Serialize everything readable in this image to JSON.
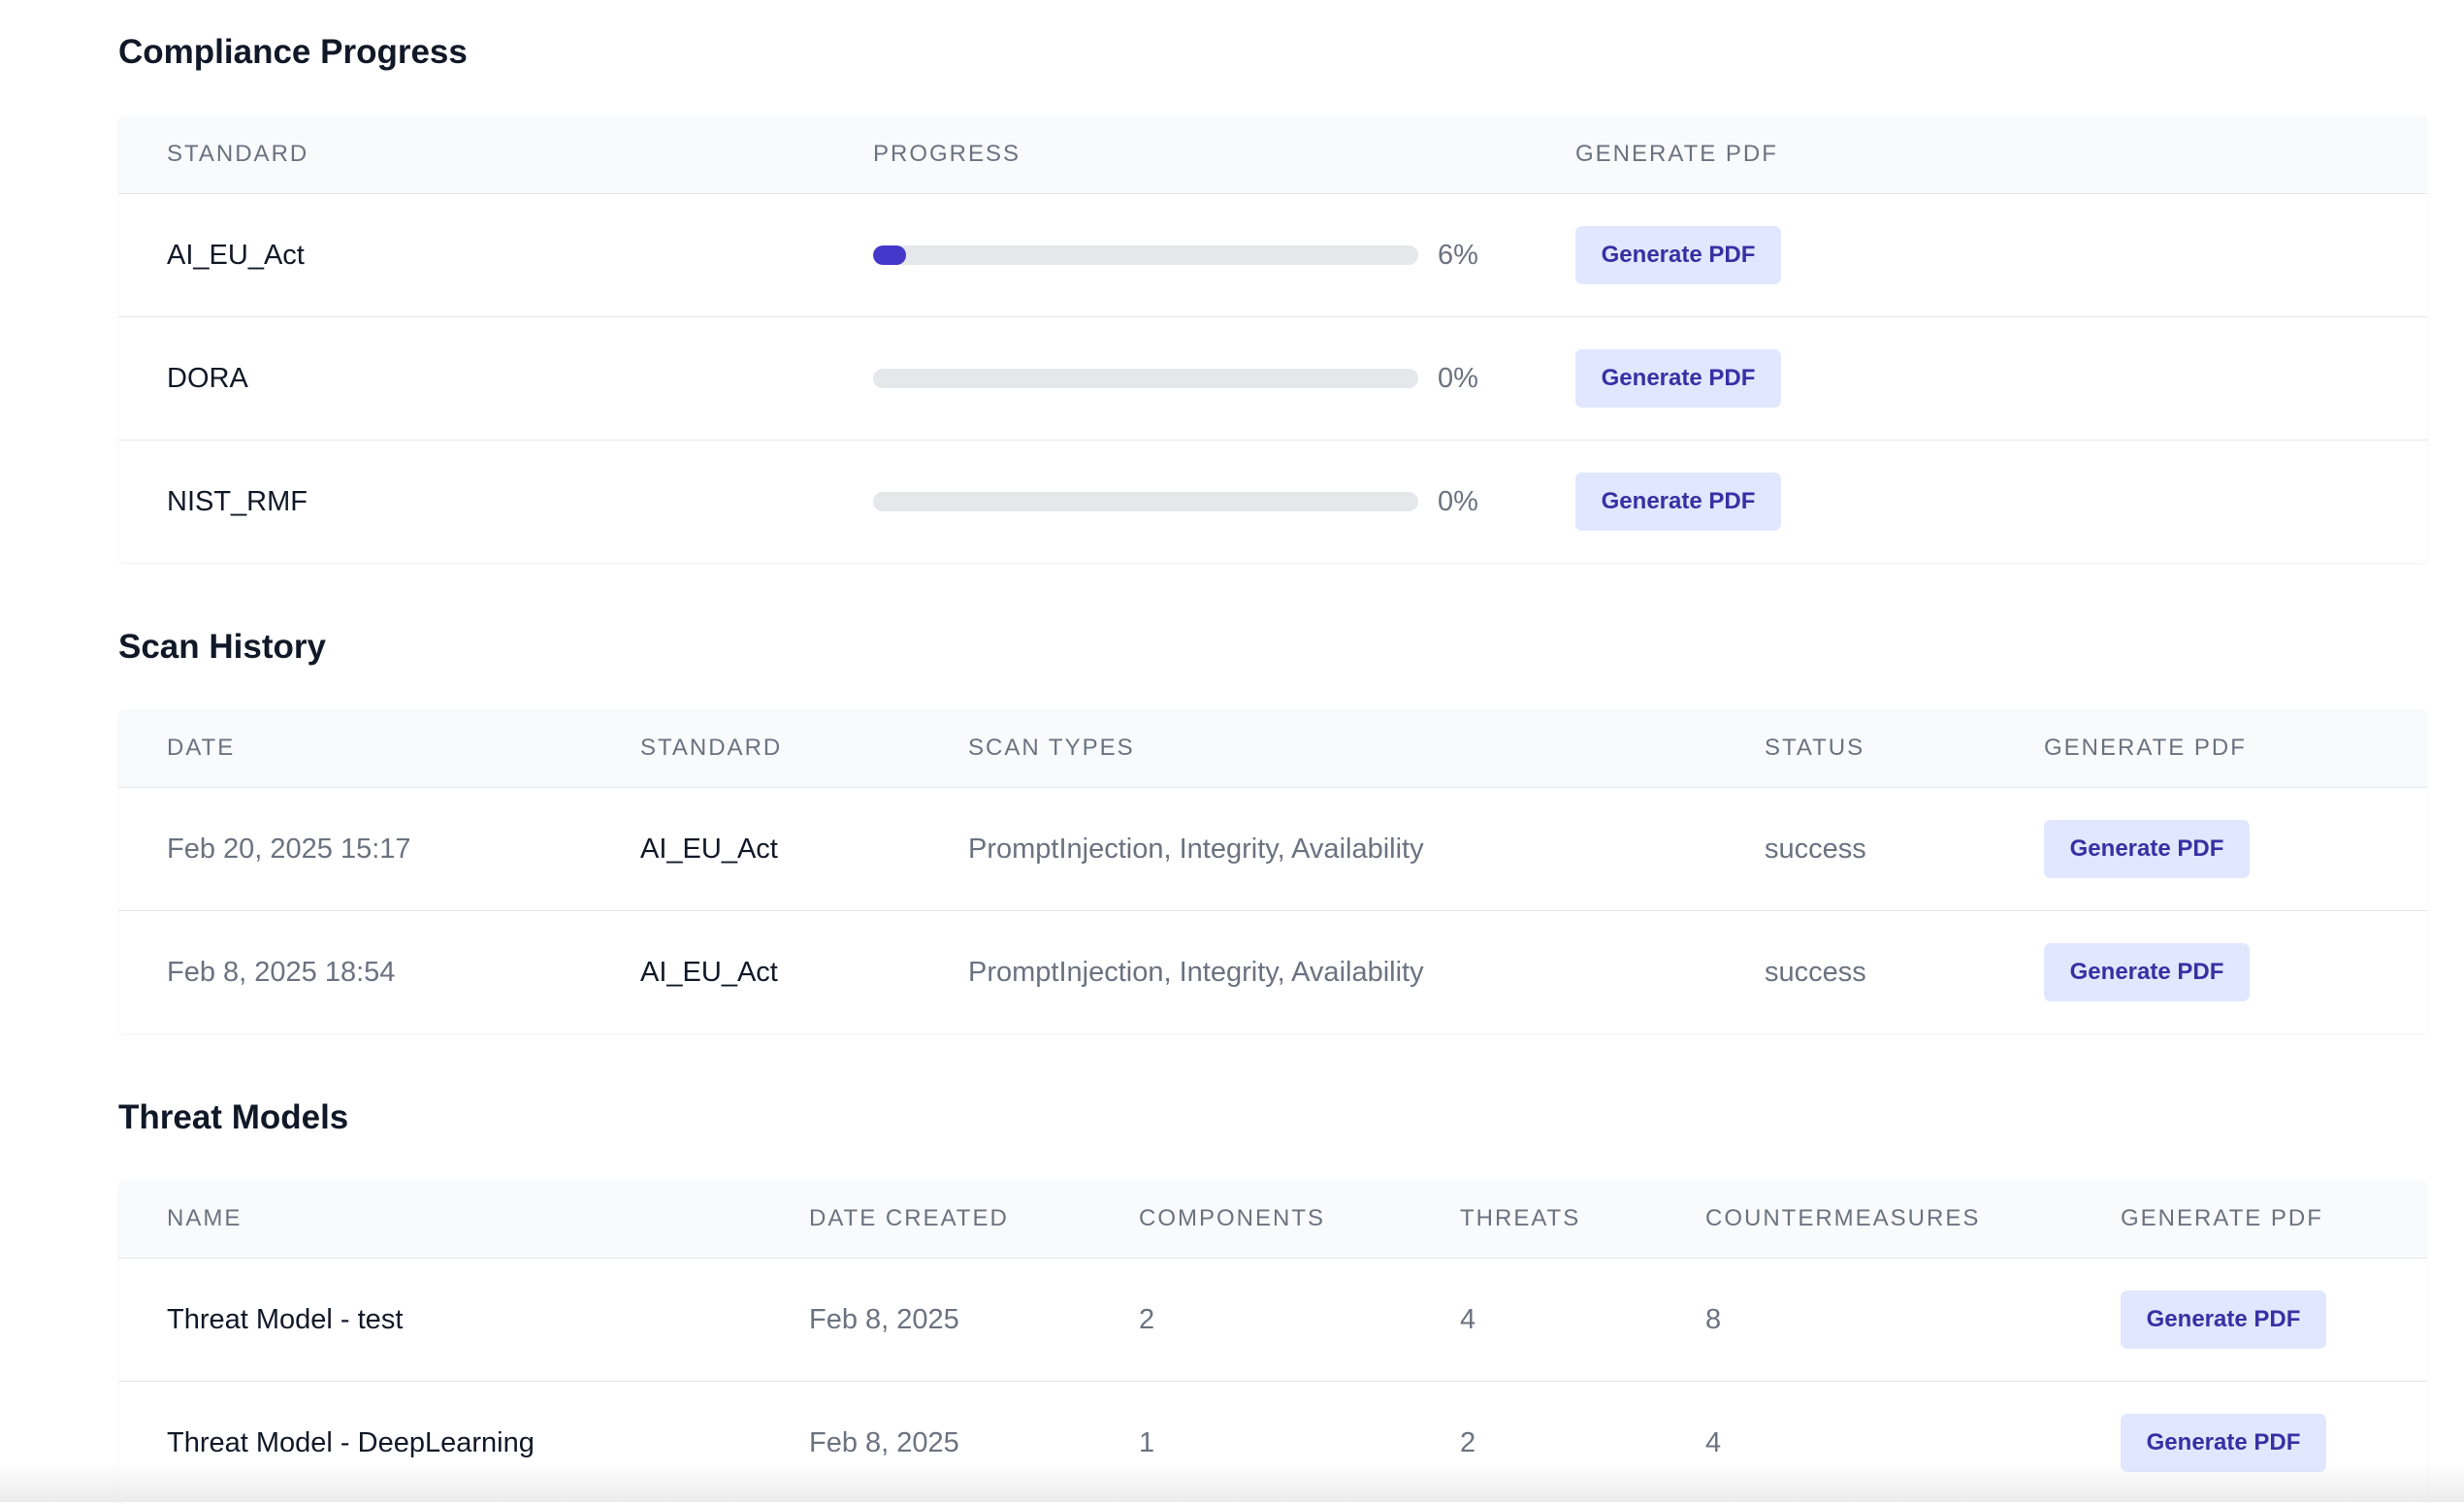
{
  "compliance": {
    "title": "Compliance Progress",
    "headers": {
      "standard": "STANDARD",
      "progress": "PROGRESS",
      "generate": "GENERATE PDF"
    },
    "rows": [
      {
        "standard": "AI_EU_Act",
        "progress": 0.06,
        "progress_label": "6%",
        "button": "Generate PDF"
      },
      {
        "standard": "DORA",
        "progress": 0.0,
        "progress_label": "0%",
        "button": "Generate PDF"
      },
      {
        "standard": "NIST_RMF",
        "progress": 0.0,
        "progress_label": "0%",
        "button": "Generate PDF"
      }
    ],
    "progress_color": "#4338ca"
  },
  "scan_history": {
    "title": "Scan History",
    "headers": {
      "date": "DATE",
      "standard": "STANDARD",
      "scan_types": "SCAN TYPES",
      "status": "STATUS",
      "generate": "GENERATE PDF"
    },
    "rows": [
      {
        "date": "Feb 20, 2025 15:17",
        "standard": "AI_EU_Act",
        "scan_types": "PromptInjection, Integrity, Availability",
        "status": "success",
        "button": "Generate PDF"
      },
      {
        "date": "Feb 8, 2025 18:54",
        "standard": "AI_EU_Act",
        "scan_types": "PromptInjection, Integrity, Availability",
        "status": "success",
        "button": "Generate PDF"
      }
    ]
  },
  "threat_models": {
    "title": "Threat Models",
    "headers": {
      "name": "NAME",
      "date_created": "DATE CREATED",
      "components": "COMPONENTS",
      "threats": "THREATS",
      "countermeasures": "COUNTERMEASURES",
      "generate": "GENERATE PDF"
    },
    "rows": [
      {
        "name": "Threat Model - test",
        "date_created": "Feb 8, 2025",
        "components": "2",
        "threats": "4",
        "countermeasures": "8",
        "button": "Generate PDF"
      },
      {
        "name": "Threat Model - DeepLearning",
        "date_created": "Feb 8, 2025",
        "components": "1",
        "threats": "2",
        "countermeasures": "4",
        "button": "Generate PDF"
      }
    ]
  },
  "colors": {
    "button_bg": "#e0e7ff",
    "button_text": "#3730a3",
    "header_bg": "#f9fafb"
  }
}
